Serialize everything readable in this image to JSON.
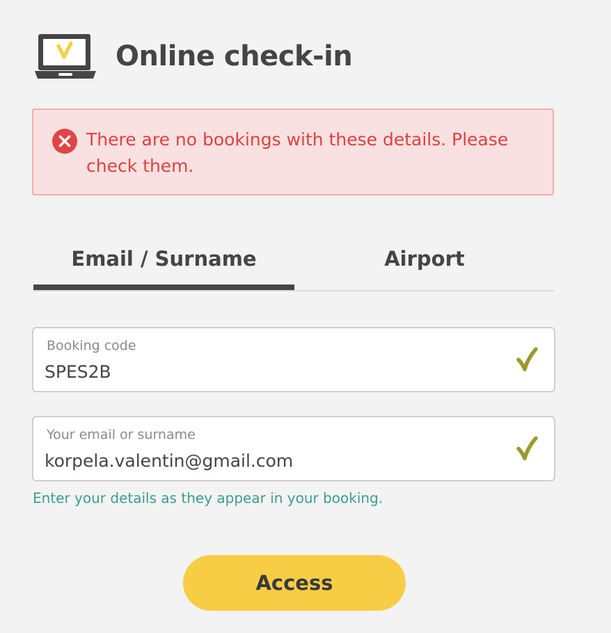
{
  "header": {
    "title": "Online check-in",
    "icon": "laptop-check-icon"
  },
  "error": {
    "icon": "error-x-icon",
    "message": "There are no bookings with these details. Please check them."
  },
  "tabs": [
    {
      "label": "Email / Surname",
      "active": true
    },
    {
      "label": "Airport",
      "active": false
    }
  ],
  "form": {
    "booking_code": {
      "label": "Booking code",
      "value": "SPES2B",
      "valid": true
    },
    "email_or_surname": {
      "label": "Your email or surname",
      "value": "korpela.valentin@gmail.com",
      "valid": true
    },
    "hint": "Enter your details as they appear in your booking.",
    "submit_label": "Access"
  },
  "colors": {
    "background": "#f3f3f3",
    "text": "#454545",
    "error_text": "#e04040",
    "error_bg": "#f8e1e0",
    "error_border": "#f3b0ac",
    "valid_check": "#9a9a2a",
    "hint": "#3a9e91",
    "button": "#f7cd45",
    "laptop_check": "#f7cd45"
  }
}
